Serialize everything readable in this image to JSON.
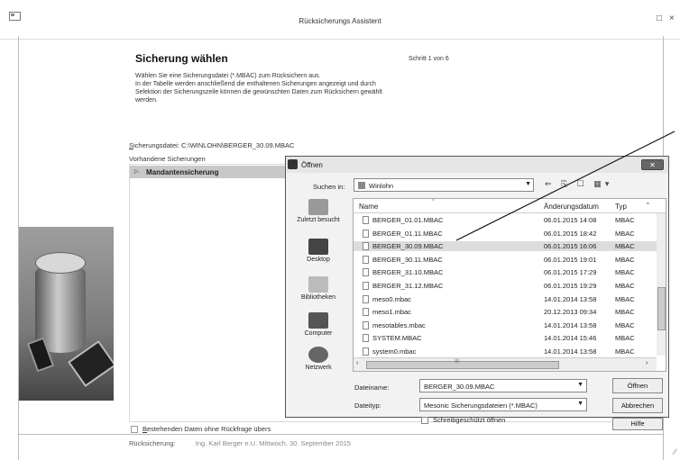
{
  "window": {
    "title": "Rücksicherungs Assistent",
    "minimize": "□",
    "close": "×"
  },
  "wizard": {
    "step_title": "Sicherung wählen",
    "step_count": "Schritt 1 von 6",
    "description": [
      "Wählen Sie eine Sicherungsdatei (*.MBAC) zum Rücksichern aus.",
      "In der Tabelle werden anschließend die enthaltenen Sicherungen angezeigt und durch",
      "Selektion der Sicherungszeile können die gewünschten Daten zum Rücksichern gewählt",
      "werden."
    ],
    "file_label_underlined": "S",
    "file_label_rest": "icherungsdatei:",
    "file_value": "C:\\WINLOHN\\BERGER_30.09.MBAC",
    "available_label": "Vorhandene Sicherungen",
    "grid_group": "Mandantensicherung",
    "overwrite_label_underlined": "B",
    "overwrite_label_rest": "estehenden Daten ohne Rückfrage übers",
    "status_label": "Rücksicherung:",
    "status_value": "Ing. Karl Berger e.U. Mittwoch, 30. September 2015"
  },
  "dialog": {
    "title": "Öffnen",
    "close": "✕",
    "lookin_label": "Suchen in:",
    "lookin_value": "Winlohn",
    "toolbar": "⇐ ⎘ ☐ ▦▾",
    "places": [
      "Zuletzt besucht",
      "Desktop",
      "Bibliotheken",
      "Computer",
      "Netzwerk"
    ],
    "columns": {
      "name": "Name",
      "date": "Änderungsdatum",
      "type": "Typ"
    },
    "files": [
      {
        "name": "BERGER_01.01.MBAC",
        "date": "06.01.2015 14:08",
        "type": "MBAC"
      },
      {
        "name": "BERGER_01.11.MBAC",
        "date": "06.01.2015 18:42",
        "type": "MBAC"
      },
      {
        "name": "BERGER_30.09.MBAC",
        "date": "06.01.2015 16:06",
        "type": "MBAC"
      },
      {
        "name": "BERGER_30.11.MBAC",
        "date": "06.01.2015 19:01",
        "type": "MBAC"
      },
      {
        "name": "BERGER_31.10.MBAC",
        "date": "06.01.2015 17:29",
        "type": "MBAC"
      },
      {
        "name": "BERGER_31.12.MBAC",
        "date": "06.01.2015 19:29",
        "type": "MBAC"
      },
      {
        "name": "meso0.mbac",
        "date": "14.01.2014 13:58",
        "type": "MBAC"
      },
      {
        "name": "meso1.mbac",
        "date": "20.12.2013 09:34",
        "type": "MBAC"
      },
      {
        "name": "mesotables.mbac",
        "date": "14.01.2014 13:58",
        "type": "MBAC"
      },
      {
        "name": "SYSTEM.MBAC",
        "date": "14.01.2014 15:46",
        "type": "MBAC"
      },
      {
        "name": "system0.mbac",
        "date": "14.01.2014 13:58",
        "type": "MBAC"
      }
    ],
    "selected_index": 2,
    "hscroll_label": "III",
    "filename_label": "Dateiname:",
    "filename_value": "BERGER_30.09.MBAC",
    "filetype_label": "Dateityp:",
    "filetype_value": "Mesonic Sicherungsdateien (*.MBAC)",
    "readonly_label": "Schreibgeschützt öffnen",
    "btn_open": "Öffnen",
    "btn_cancel": "Abbrechen",
    "btn_help": "Hilfe"
  }
}
